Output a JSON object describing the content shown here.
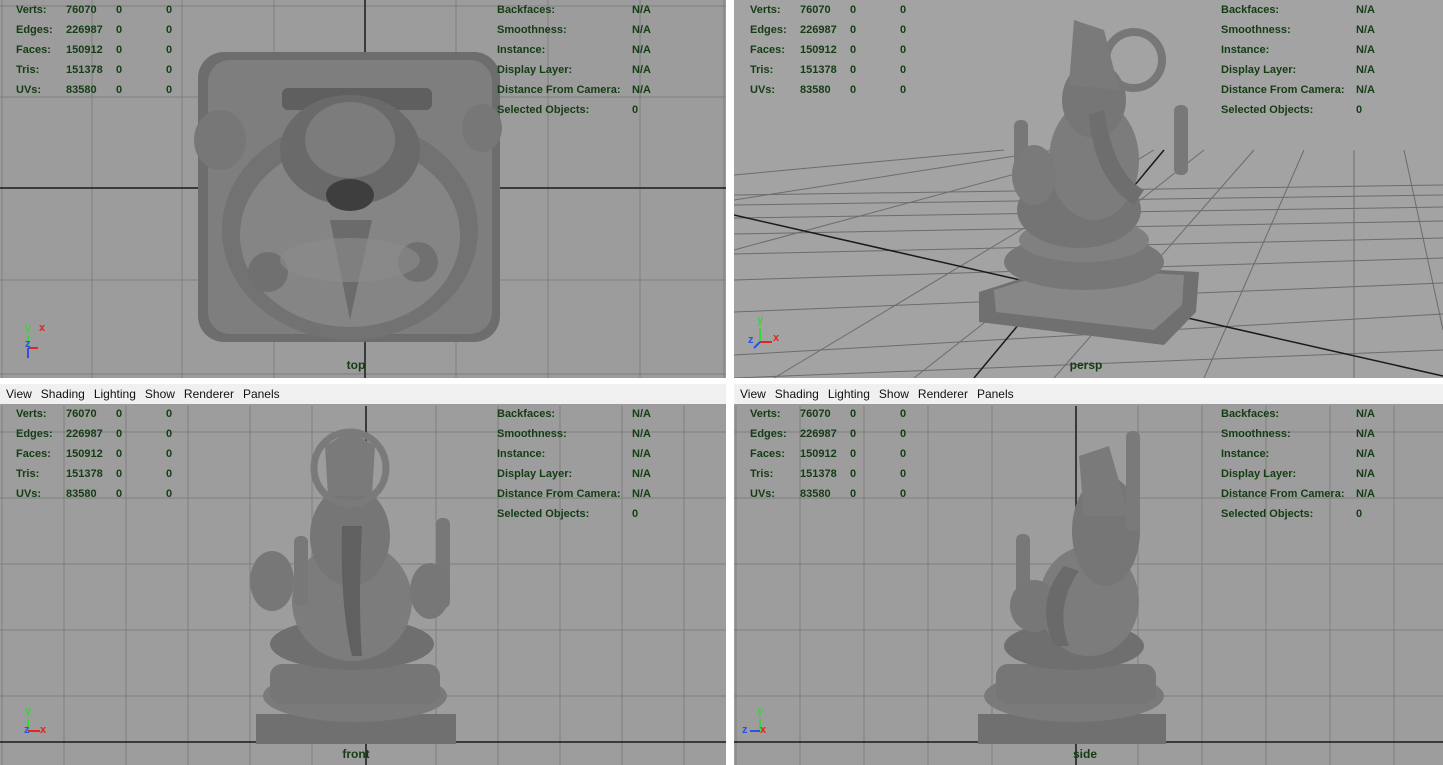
{
  "menu": [
    "View",
    "Shading",
    "Lighting",
    "Show",
    "Renderer",
    "Panels"
  ],
  "stats": {
    "rows": [
      {
        "label": "Verts:",
        "v1": "76070",
        "v2": "0",
        "v3": "0"
      },
      {
        "label": "Edges:",
        "v1": "226987",
        "v2": "0",
        "v3": "0"
      },
      {
        "label": "Faces:",
        "v1": "150912",
        "v2": "0",
        "v3": "0"
      },
      {
        "label": "Tris:",
        "v1": "151378",
        "v2": "0",
        "v3": "0"
      },
      {
        "label": "UVs:",
        "v1": "83580",
        "v2": "0",
        "v3": "0"
      }
    ],
    "props": [
      {
        "label": "Backfaces:",
        "value": "N/A"
      },
      {
        "label": "Smoothness:",
        "value": "N/A"
      },
      {
        "label": "Instance:",
        "value": "N/A"
      },
      {
        "label": "Display Layer:",
        "value": "N/A"
      },
      {
        "label": "Distance From Camera:",
        "value": "N/A"
      },
      {
        "label": "Selected Objects:",
        "value": "0"
      }
    ]
  },
  "axes": {
    "x": "x",
    "y": "y",
    "z": "z"
  },
  "colors": {
    "axis_x": "#e0261f",
    "axis_y": "#3ad43a",
    "axis_z": "#2a52e6",
    "hud_text": "#143d14"
  },
  "panels": {
    "top": {
      "camera": "top"
    },
    "persp": {
      "camera": "persp"
    },
    "front": {
      "camera": "front"
    },
    "side": {
      "camera": "side"
    }
  }
}
